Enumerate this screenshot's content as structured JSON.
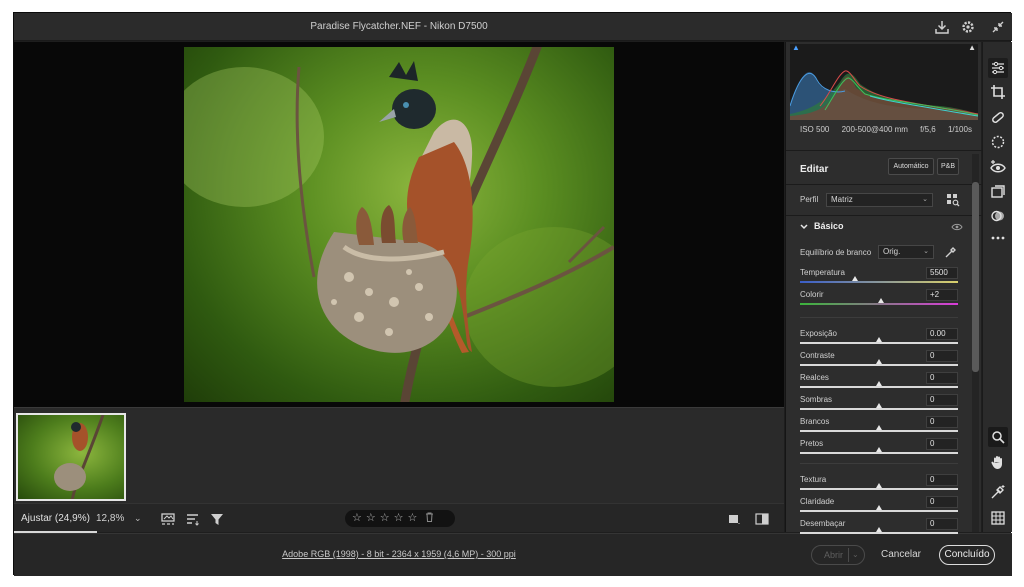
{
  "window": {
    "title": "Paradise Flycatcher.NEF  -  Nikon D7500"
  },
  "header_icons": [
    "save-icon",
    "gear-icon",
    "collapse-icon"
  ],
  "histogram": {
    "clipping_shadow": "▲",
    "clipping_highlight": "▲"
  },
  "camera_info": {
    "iso": "ISO 500",
    "lens": "200-500@400 mm",
    "aperture": "f/5,6",
    "shutter": "1/100s"
  },
  "panel": {
    "edit_title": "Editar",
    "auto_button": "Automático",
    "bw_button": "P&B",
    "profile_label": "Perfil",
    "profile_value": "Matriz",
    "section_title": "Básico",
    "wb_label": "Equilíbrio de branco",
    "wb_value": "Orig.",
    "sliders": [
      {
        "label": "Temperatura",
        "value": "5500",
        "position": 0.35
      },
      {
        "label": "Colorir",
        "value": "+2",
        "position": 0.51
      },
      {
        "label": "Exposição",
        "value": "0.00",
        "position": 0.5
      },
      {
        "label": "Contraste",
        "value": "0",
        "position": 0.5
      },
      {
        "label": "Realces",
        "value": "0",
        "position": 0.5
      },
      {
        "label": "Sombras",
        "value": "0",
        "position": 0.5
      },
      {
        "label": "Brancos",
        "value": "0",
        "position": 0.5
      },
      {
        "label": "Pretos",
        "value": "0",
        "position": 0.5
      },
      {
        "label": "Textura",
        "value": "0",
        "position": 0.5
      },
      {
        "label": "Claridade",
        "value": "0",
        "position": 0.5
      },
      {
        "label": "Desembaçar",
        "value": "0",
        "position": 0.5
      }
    ]
  },
  "bottom_bar": {
    "zoom_fit": "Ajustar (24,9%)",
    "zoom_value": "12,8%",
    "zoom_caret": "⌄",
    "stars": [
      "☆",
      "☆",
      "☆",
      "☆",
      "☆"
    ],
    "trash": "🗑"
  },
  "footer": {
    "file_info": "Adobe RGB (1998) - 8 bit - 2364 x 1959 (4,6 MP) - 300 ppi",
    "open_label": "Abrir",
    "cancel_label": "Cancelar",
    "done_label": "Concluído"
  },
  "tools": [
    "sliders-icon",
    "crop-icon",
    "healing-icon",
    "mask-icon",
    "redeye-icon",
    "snapshots-icon",
    "presets-icon",
    "more-icon",
    "zoom-icon",
    "hand-icon",
    "color-sampler-icon",
    "grid-icon"
  ]
}
